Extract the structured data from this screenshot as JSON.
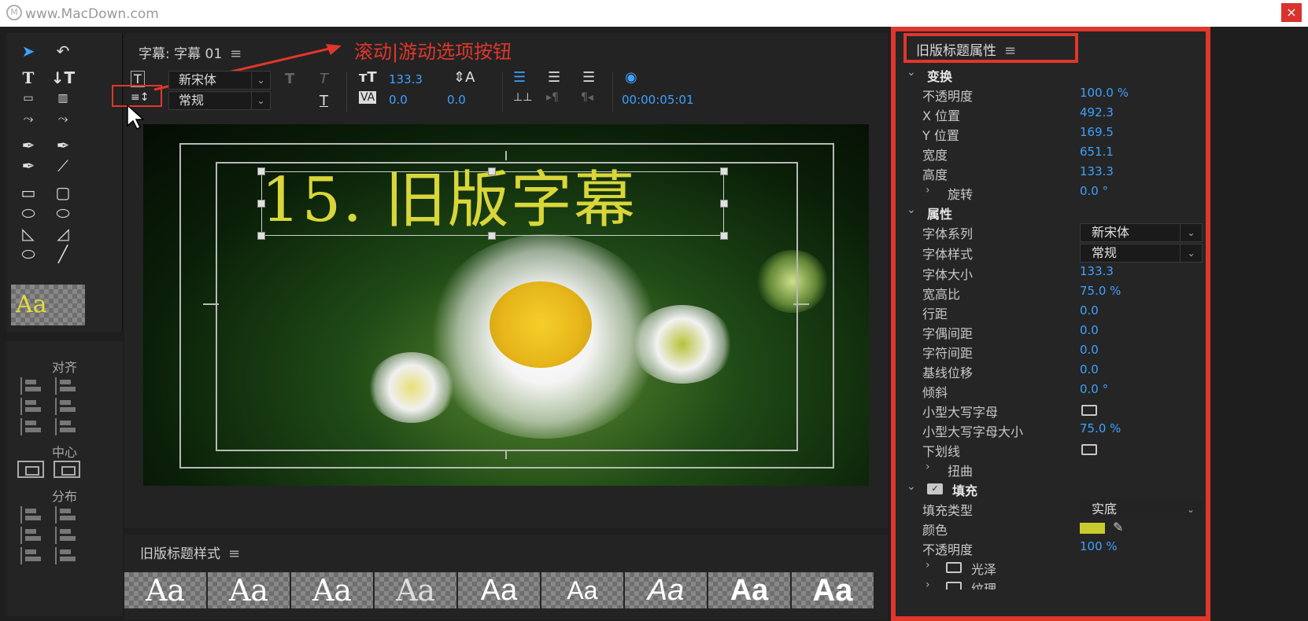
{
  "watermark": "www.MacDown.com",
  "window": {
    "close_glyph": "×"
  },
  "editor": {
    "title": "字幕: 字幕 01",
    "menu_glyph": "≡",
    "annotation": "滚动|游动选项按钮",
    "font_family": "新宋体",
    "font_style": "常规",
    "font_size": "133.3",
    "kerning": "0.0",
    "leading": "0.0",
    "timecode": "00:00:05:01",
    "caption": "15. 旧版字幕"
  },
  "tools": {
    "aa_sample": "Aa",
    "align_label": "对齐",
    "center_label": "中心",
    "distribute_label": "分布"
  },
  "styles": {
    "header": "旧版标题样式",
    "swatches": [
      "Aa",
      "Aa",
      "Aa",
      "Aa",
      "Aa",
      "Aa",
      "Aa",
      "Aa",
      "Aa"
    ]
  },
  "properties": {
    "header": "旧版标题属性",
    "transform": {
      "label": "变换",
      "opacity_label": "不透明度",
      "opacity": "100.0 %",
      "x_label": "X 位置",
      "x": "492.3",
      "y_label": "Y 位置",
      "y": "169.5",
      "width_label": "宽度",
      "width": "651.1",
      "height_label": "高度",
      "height": "133.3",
      "rotation_label": "旋转",
      "rotation": "0.0 °"
    },
    "attributes": {
      "label": "属性",
      "font_family_label": "字体系列",
      "font_family": "新宋体",
      "font_style_label": "字体样式",
      "font_style": "常规",
      "font_size_label": "字体大小",
      "font_size": "133.3",
      "aspect_label": "宽高比",
      "aspect": "75.0 %",
      "leading_label": "行距",
      "leading": "0.0",
      "kerning_label": "字偶间距",
      "kerning": "0.0",
      "tracking_label": "字符间距",
      "tracking": "0.0",
      "baseline_label": "基线位移",
      "baseline": "0.0",
      "slant_label": "倾斜",
      "slant": "0.0 °",
      "smallcaps_label": "小型大写字母",
      "smallcaps_size_label": "小型大写字母大小",
      "smallcaps_size": "75.0 %",
      "underline_label": "下划线",
      "distort_label": "扭曲"
    },
    "fill": {
      "label": "填充",
      "type_label": "填充类型",
      "type": "实底",
      "color_label": "颜色",
      "color": "#c9cc2e",
      "opacity_label": "不透明度",
      "opacity": "100 %",
      "sheen_label": "光泽",
      "texture_label": "纹理"
    }
  },
  "colors": {
    "accent_blue": "#3ea1ff",
    "annotation_red": "#e0372b",
    "title_yellow": "#d9d63a"
  }
}
